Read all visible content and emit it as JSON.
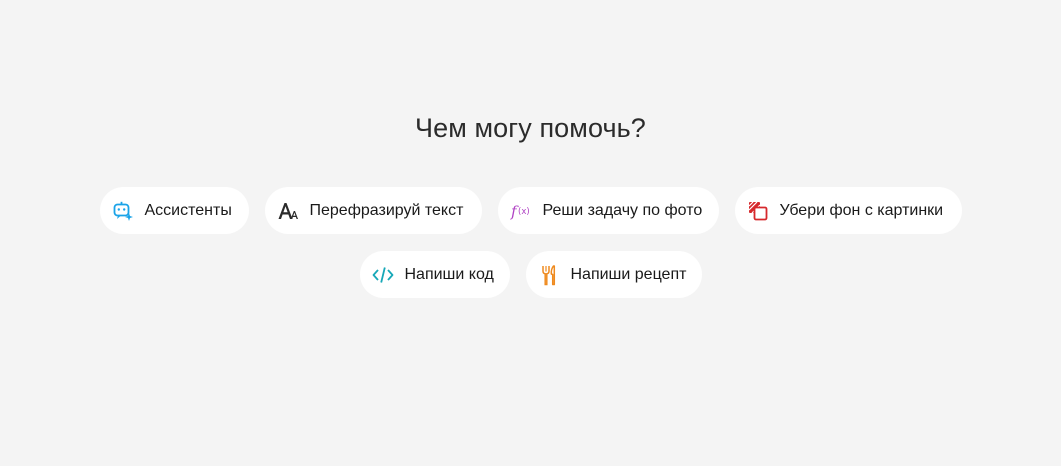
{
  "heading": "Чем могу помочь?",
  "suggestions": [
    {
      "label": "Ассистенты",
      "icon": "assistant-bot-icon",
      "color": "#1aa3e8"
    },
    {
      "label": "Перефразируй текст",
      "icon": "font-size-icon",
      "color": "#2b2b2b"
    },
    {
      "label": "Реши задачу по фото",
      "icon": "function-icon",
      "color": "#b043c4"
    },
    {
      "label": "Убери фон с картинки",
      "icon": "remove-background-icon",
      "color": "#d6282c"
    },
    {
      "label": "Напиши код",
      "icon": "code-icon",
      "color": "#17a8b8"
    },
    {
      "label": "Напиши рецепт",
      "icon": "cutlery-icon",
      "color": "#ef8a1e"
    }
  ]
}
